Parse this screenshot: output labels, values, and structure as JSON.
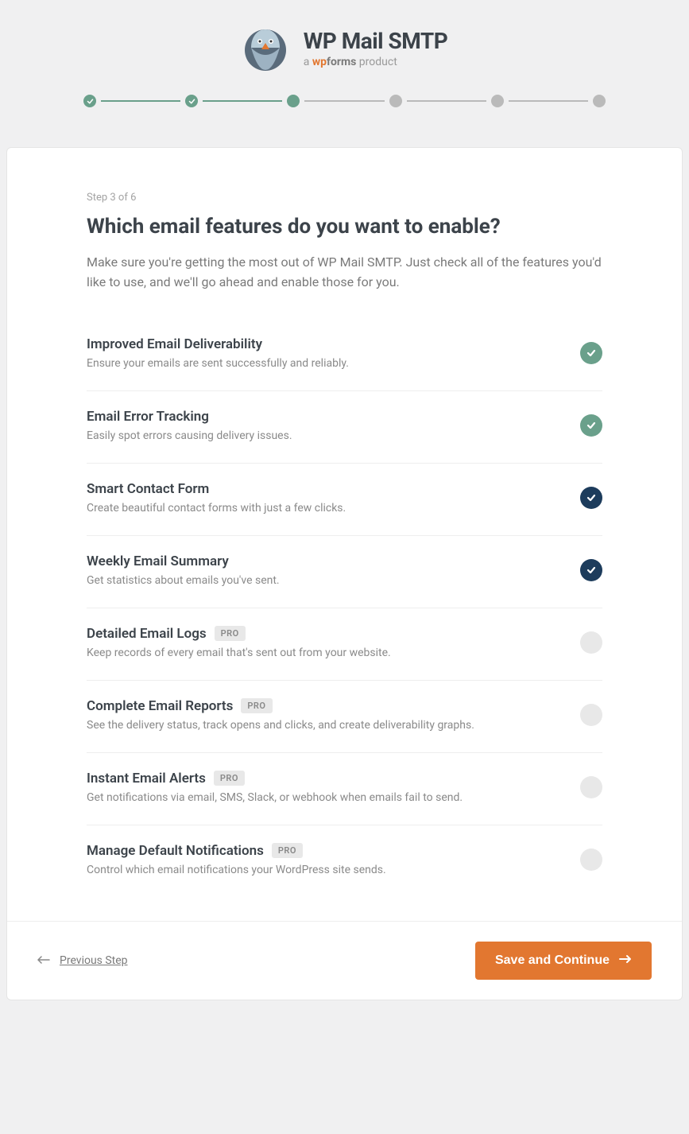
{
  "header": {
    "title": "WP Mail SMTP",
    "subtitle_prefix": "a ",
    "subtitle_brand_a": "wp",
    "subtitle_brand_b": "forms",
    "subtitle_suffix": " product"
  },
  "stepper": {
    "total": 6,
    "current": 3
  },
  "card": {
    "step_label": "Step 3 of 6",
    "heading": "Which email features do you want to enable?",
    "subheading": "Make sure you're getting the most out of WP Mail SMTP. Just check all of the features you'd like to use, and we'll go ahead and enable those for you."
  },
  "features": [
    {
      "title": "Improved Email Deliverability",
      "desc": "Ensure your emails are sent successfully and reliably.",
      "pro": false,
      "state": "on-locked"
    },
    {
      "title": "Email Error Tracking",
      "desc": "Easily spot errors causing delivery issues.",
      "pro": false,
      "state": "on-locked"
    },
    {
      "title": "Smart Contact Form",
      "desc": "Create beautiful contact forms with just a few clicks.",
      "pro": false,
      "state": "on"
    },
    {
      "title": "Weekly Email Summary",
      "desc": "Get statistics about emails you've sent.",
      "pro": false,
      "state": "on"
    },
    {
      "title": "Detailed Email Logs",
      "desc": "Keep records of every email that's sent out from your website.",
      "pro": true,
      "state": "off"
    },
    {
      "title": "Complete Email Reports",
      "desc": "See the delivery status, track opens and clicks, and create deliverability graphs.",
      "pro": true,
      "state": "off"
    },
    {
      "title": "Instant Email Alerts",
      "desc": "Get notifications via email, SMS, Slack, or webhook when emails fail to send.",
      "pro": true,
      "state": "off"
    },
    {
      "title": "Manage Default Notifications",
      "desc": "Control which email notifications your WordPress site sends.",
      "pro": true,
      "state": "off"
    }
  ],
  "badges": {
    "pro": "PRO"
  },
  "footer": {
    "prev": "Previous Step",
    "save": "Save and Continue"
  }
}
